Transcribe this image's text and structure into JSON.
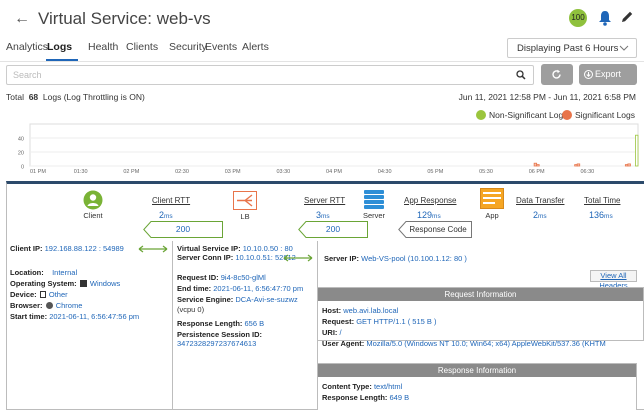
{
  "header": {
    "title": "Virtual Service:  web-vs",
    "health_score": "100"
  },
  "tabs": [
    {
      "label": "Analytics"
    },
    {
      "label": "Logs"
    },
    {
      "label": "Health"
    },
    {
      "label": "Clients"
    },
    {
      "label": "Security"
    },
    {
      "label": "Events"
    },
    {
      "label": "Alerts"
    }
  ],
  "time_range_select": {
    "value": "Displaying Past 6 Hours"
  },
  "search": {
    "placeholder": "Search"
  },
  "export_label": "Export",
  "summary": {
    "prefix": "Total",
    "count": "68",
    "suffix": "Logs (Log Throttling is ON)",
    "range": "Jun 11, 2021 12:58 PM - Jun 11, 2021 6:58 PM"
  },
  "legend": {
    "non_significant": "Non-Significant Logs",
    "significant": "Significant Logs"
  },
  "colors": {
    "non_significant": "#9bc53d",
    "significant": "#e8744a",
    "brand": "#1f66b8"
  },
  "chart_data": {
    "type": "bar",
    "x_ticks": [
      "01 PM",
      "01:30",
      "02 PM",
      "02:30",
      "03 PM",
      "03:30",
      "04 PM",
      "04:30",
      "05 PM",
      "05:30",
      "06 PM",
      "06:30"
    ],
    "y_ticks": [
      "40",
      "20",
      "0"
    ],
    "ylim": [
      0,
      60
    ],
    "series": [
      {
        "name": "Non-Significant Logs",
        "values": [
          0,
          0,
          0,
          0,
          0,
          0,
          0,
          0,
          0,
          0,
          0,
          0,
          0,
          0,
          0,
          0,
          0,
          0,
          0,
          0,
          0,
          0,
          0,
          0,
          0,
          0,
          0,
          0,
          0,
          0,
          0,
          0,
          0,
          0,
          0,
          0,
          0,
          0,
          0,
          0,
          0,
          0,
          0,
          0,
          0,
          0,
          0,
          0,
          0,
          0,
          0,
          0,
          0,
          0,
          0,
          0,
          0,
          0,
          0,
          0,
          0,
          0,
          0,
          0,
          0,
          0,
          0,
          0,
          0,
          0,
          0,
          0,
          0,
          0,
          0,
          0,
          0,
          0,
          0,
          0,
          0,
          0,
          0,
          0,
          0,
          0,
          0,
          0,
          0,
          0,
          0,
          0,
          0,
          0,
          0,
          0,
          0,
          0,
          0,
          0,
          0,
          0,
          0,
          0,
          0,
          0,
          0,
          0,
          0,
          0,
          0,
          0,
          0,
          0,
          0,
          0,
          0,
          0,
          0,
          0,
          0,
          0,
          0,
          0,
          0,
          0,
          0,
          0,
          0,
          0,
          0,
          0,
          0,
          0,
          0,
          0,
          0,
          0,
          0,
          0,
          0,
          0,
          0,
          0,
          0,
          0,
          0,
          0,
          0,
          0,
          0,
          0,
          0,
          0,
          0,
          0,
          0,
          0,
          0,
          0,
          0,
          0,
          0,
          0,
          0,
          0,
          0,
          0,
          0,
          0,
          0,
          0,
          0,
          0,
          0,
          0,
          0,
          0,
          0,
          0,
          0,
          0,
          0,
          0,
          0,
          0,
          0,
          0,
          0,
          0,
          0,
          0,
          0,
          0,
          0,
          0,
          0,
          0,
          0,
          0,
          0,
          0,
          0,
          0,
          0,
          0,
          0,
          0,
          0,
          0,
          0,
          0,
          0,
          0,
          0,
          0,
          0,
          0,
          0,
          0,
          0,
          0,
          0,
          0,
          0,
          0,
          0,
          0,
          0,
          0,
          0,
          0,
          0,
          0,
          0,
          0,
          0,
          0,
          0,
          44
        ]
      },
      {
        "name": "Significant Logs",
        "values": [
          0,
          0,
          0,
          0,
          0,
          0,
          0,
          0,
          0,
          0,
          0,
          0,
          0,
          0,
          0,
          0,
          0,
          0,
          0,
          0,
          0,
          0,
          0,
          0,
          0,
          0,
          0,
          0,
          0,
          0,
          0,
          0,
          0,
          0,
          0,
          0,
          0,
          0,
          0,
          0,
          0,
          0,
          0,
          0,
          0,
          0,
          0,
          0,
          0,
          0,
          0,
          0,
          0,
          0,
          0,
          0,
          0,
          0,
          0,
          0,
          0,
          0,
          0,
          0,
          0,
          0,
          0,
          0,
          0,
          0,
          0,
          0,
          0,
          0,
          0,
          0,
          0,
          0,
          0,
          0,
          0,
          0,
          0,
          0,
          0,
          0,
          0,
          0,
          0,
          0,
          0,
          0,
          0,
          0,
          0,
          0,
          0,
          0,
          0,
          0,
          0,
          0,
          0,
          0,
          0,
          0,
          0,
          0,
          0,
          0,
          0,
          0,
          0,
          0,
          0,
          0,
          0,
          0,
          0,
          0,
          0,
          0,
          0,
          0,
          0,
          0,
          0,
          0,
          0,
          0,
          0,
          0,
          0,
          0,
          0,
          0,
          0,
          0,
          0,
          0,
          0,
          0,
          0,
          0,
          0,
          0,
          0,
          0,
          0,
          0,
          0,
          0,
          0,
          0,
          0,
          0,
          0,
          0,
          0,
          0,
          0,
          0,
          0,
          0,
          0,
          0,
          0,
          0,
          0,
          0,
          0,
          0,
          0,
          0,
          0,
          0,
          0,
          0,
          0,
          0,
          0,
          0,
          0,
          0,
          0,
          0,
          0,
          0,
          0,
          0,
          0,
          0,
          0,
          0,
          0,
          0,
          0,
          0,
          0,
          4,
          2,
          0,
          0,
          0,
          0,
          0,
          0,
          0,
          0,
          0,
          0,
          0,
          0,
          0,
          0,
          2,
          3,
          0,
          0,
          0,
          0,
          0,
          0,
          0,
          0,
          0,
          0,
          0,
          0,
          0,
          0,
          0,
          0,
          0,
          0,
          2,
          3,
          0,
          0,
          0,
          0,
          0,
          0,
          0,
          0,
          0,
          0,
          3,
          2,
          0,
          0,
          0,
          0,
          0,
          0,
          0,
          0,
          0,
          0,
          0,
          0,
          0,
          0,
          0,
          0,
          0,
          0,
          0,
          0,
          0,
          6
        ]
      }
    ]
  },
  "flow": {
    "client_label": "Client",
    "client_rtt": {
      "label": "Client RTT",
      "value": "2",
      "unit": "ms"
    },
    "lb_label": "LB",
    "server_rtt": {
      "label": "Server RTT",
      "value": "3",
      "unit": "ms"
    },
    "server_label": "Server",
    "app_response": {
      "label": "App Response",
      "value": "129",
      "unit": "ms"
    },
    "app_label": "App",
    "data_transfer": {
      "label": "Data Transfer",
      "value": "2",
      "unit": "ms"
    },
    "total_time": {
      "label": "Total Time",
      "value": "136",
      "unit": "ms"
    },
    "client_status": "200",
    "server_status": "200",
    "response_code_label": "Response Code"
  },
  "client": {
    "ip_label": "Client IP:",
    "ip": "192.168.88.122 : 54989",
    "location_label": "Location:",
    "location": "Internal",
    "os_label": "Operating System:",
    "os": "Windows",
    "device_label": "Device:",
    "device": "Other",
    "browser_label": "Browser:",
    "browser": "Chrome",
    "start_label": "Start time:",
    "start": "2021-06-11, 6:56:47:56 pm"
  },
  "vs": {
    "vs_ip_label": "Virtual Service IP:",
    "vs_ip": "10.10.0.50 : 80",
    "conn_ip_label": "Server Conn IP:",
    "conn_ip": "10.10.0.51: 52812",
    "request_id_label": "Request ID:",
    "request_id": "9i4-8c50-glMl",
    "end_label": "End time:",
    "end": "2021-06-11, 6:56:47:70 pm",
    "se_label": "Service Engine:",
    "se": "DCA-Avi-se-suzwz",
    "se_extra": "(vcpu 0)",
    "resp_len_label": "Response Length:",
    "resp_len": "656 B",
    "persist_label": "Persistence Session ID:",
    "persist": "347232829723767461​3"
  },
  "server": {
    "ip_label": "Server IP:",
    "ip": "Web-VS-pool",
    "ip_extra": "(10.100.1.12: 80 )"
  },
  "view_all_headers": "View All Headers",
  "request_info": {
    "title": "Request Information",
    "host_label": "Host:",
    "host": "web.avi.lab.local",
    "request_label": "Request:",
    "request": "GET HTTP/1.1 ( 515 B )",
    "uri_label": "URI:",
    "uri": "/",
    "ua_label": "User Agent:",
    "ua": "Mozilla/5.0 (Windows NT 10.0; Win64; x64) AppleWebKit/537.36 (KHTM"
  },
  "response_info": {
    "title": "Response Information",
    "ct_label": "Content Type:",
    "ct": "text/html",
    "len_label": "Response Length:",
    "len": "649 B"
  }
}
